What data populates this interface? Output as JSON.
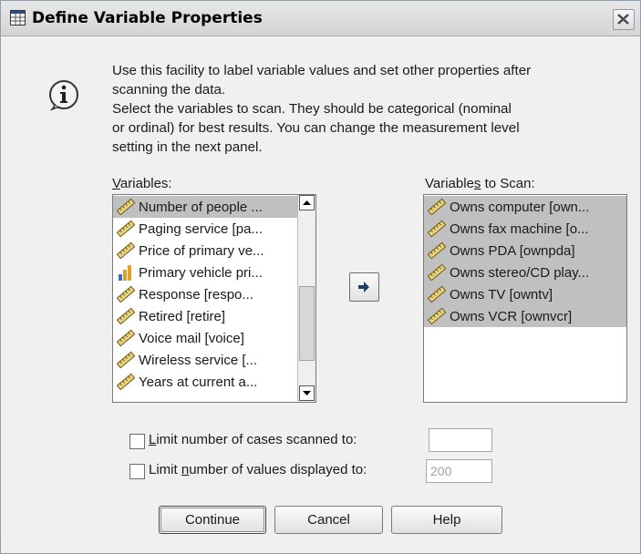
{
  "window": {
    "title": "Define Variable Properties"
  },
  "description": {
    "line1": "Use this facility to label variable values and set other properties after",
    "line2": "scanning the data.",
    "line3": "Select the variables to scan. They should be categorical (nominal",
    "line4": "or ordinal) for best results. You can change the measurement level",
    "line5": "setting in the next panel."
  },
  "variables": {
    "label_mnemonic": "V",
    "label_rest": "ariables:",
    "items": [
      {
        "label": "Number of people ...",
        "icon": "scale-ruler-icon",
        "selected": true
      },
      {
        "label": "Paging service [pa...",
        "icon": "scale-ruler-icon",
        "selected": false
      },
      {
        "label": "Price of primary ve...",
        "icon": "scale-ruler-icon",
        "selected": false
      },
      {
        "label": "Primary vehicle pri...",
        "icon": "ordinal-bars-icon",
        "selected": false
      },
      {
        "label": "Response [respo...",
        "icon": "scale-ruler-icon",
        "selected": false
      },
      {
        "label": "Retired [retire]",
        "icon": "scale-ruler-icon",
        "selected": false
      },
      {
        "label": "Voice mail [voice]",
        "icon": "scale-ruler-icon",
        "selected": false
      },
      {
        "label": "Wireless service [...",
        "icon": "scale-ruler-icon",
        "selected": false
      },
      {
        "label": "Years at current a...",
        "icon": "scale-ruler-icon",
        "selected": false
      }
    ]
  },
  "scan": {
    "label_before": "Variable",
    "label_mnemonic": "s",
    "label_after": " to Scan:",
    "items": [
      {
        "label": "Owns computer [own...",
        "icon": "scale-ruler-icon"
      },
      {
        "label": "Owns fax machine [o...",
        "icon": "scale-ruler-icon"
      },
      {
        "label": "Owns PDA [ownpda]",
        "icon": "scale-ruler-icon"
      },
      {
        "label": "Owns stereo/CD play...",
        "icon": "scale-ruler-icon"
      },
      {
        "label": "Owns TV [owntv]",
        "icon": "scale-ruler-icon"
      },
      {
        "label": "Owns VCR [ownvcr]",
        "icon": "scale-ruler-icon"
      }
    ]
  },
  "move_button_icon": "right-arrow-icon",
  "options": {
    "limit_cases": {
      "mnemonic": "L",
      "rest": "imit number of cases scanned to:",
      "checked": false,
      "value": ""
    },
    "limit_values": {
      "before": "Limit ",
      "mnemonic": "n",
      "rest": "umber of values displayed to:",
      "checked": false,
      "value": "200"
    }
  },
  "buttons": {
    "continue": "Continue",
    "cancel": "Cancel",
    "help": "Help"
  }
}
